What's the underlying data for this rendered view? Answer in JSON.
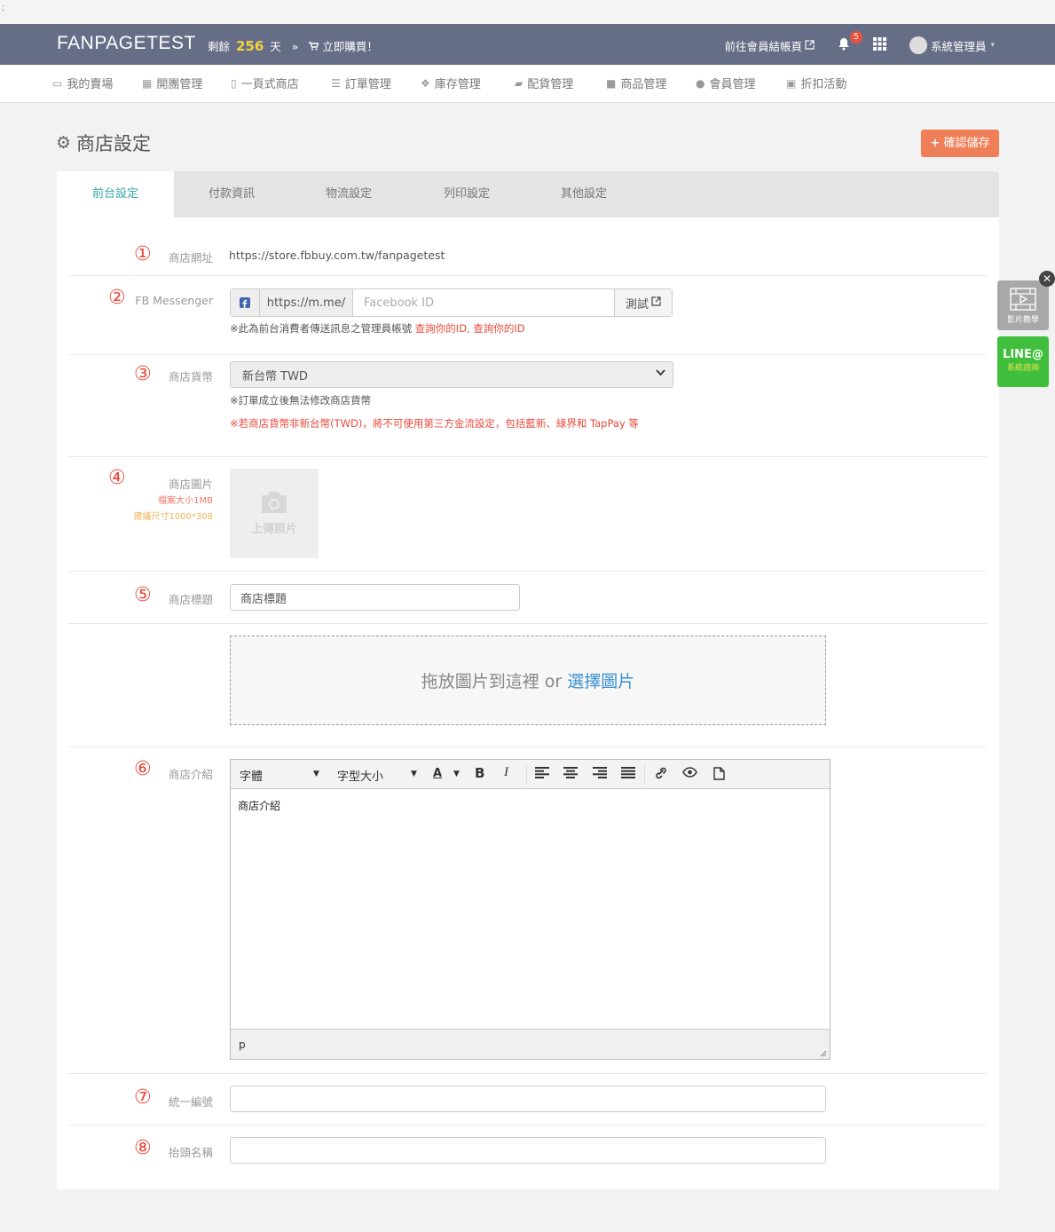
{
  "strip": {
    "text": ";"
  },
  "header": {
    "brand": "FANPAGETEST",
    "remain_prefix": "剩餘",
    "remain_days": "256",
    "remain_suffix": "天",
    "arrow": "»",
    "buy_label": "立即購買！",
    "member_checkout": "前往會員結帳頁",
    "notification_count": "5",
    "user_name": "系統管理員"
  },
  "nav": {
    "items": [
      {
        "label": "我的賣場",
        "icon": "store-icon"
      },
      {
        "label": "開團管理",
        "icon": "calendar-icon"
      },
      {
        "label": "一頁式商店",
        "icon": "file-icon"
      },
      {
        "label": "訂單管理",
        "icon": "list-icon"
      },
      {
        "label": "庫存管理",
        "icon": "cubes-icon"
      },
      {
        "label": "配貨管理",
        "icon": "truck-icon"
      },
      {
        "label": "商品管理",
        "icon": "archive-icon"
      },
      {
        "label": "會員管理",
        "icon": "users-icon"
      },
      {
        "label": "折扣活動",
        "icon": "money-icon"
      }
    ]
  },
  "page": {
    "title": "商店設定",
    "save_label": "確認儲存"
  },
  "tabs": [
    {
      "label": "前台設定",
      "active": true
    },
    {
      "label": "付款資訊",
      "active": false
    },
    {
      "label": "物流設定",
      "active": false
    },
    {
      "label": "列印設定",
      "active": false
    },
    {
      "label": "其他設定",
      "active": false
    }
  ],
  "form": {
    "url": {
      "num": "①",
      "label": "商店網址",
      "value": "https://store.fbbuy.com.tw/fanpagetest"
    },
    "messenger": {
      "num": "②",
      "label": "FB Messenger",
      "prefix": "https://m.me/",
      "placeholder": "Facebook ID",
      "test_label": "測試",
      "note_prefix": "※此為前台消費者傳送訊息之管理員帳號",
      "note_link": "查詢你的ID, 查詢你的ID"
    },
    "currency": {
      "num": "③",
      "label": "商店貨幣",
      "selected": "新台幣 TWD",
      "note1": "※訂單成立後無法修改商店貨幣",
      "note2": "※若商店貨幣非新台幣(TWD)，將不可使用第三方金流設定，包括藍新、綠界和 TapPay 等"
    },
    "image": {
      "num": "④",
      "label": "商店圖片",
      "size_note": "檔案大小1MB",
      "dim_note": "建議尺寸1000*308",
      "upload_label": "上傳照片"
    },
    "title": {
      "num": "⑤",
      "label": "商店標題",
      "value": "商店標題"
    },
    "dropzone": {
      "text": "拖放圖片到這裡 or",
      "link": "選擇圖片"
    },
    "intro": {
      "num": "⑥",
      "label": "商店介紹",
      "font_label": "字體",
      "size_label": "字型大小",
      "content": "商店介紹",
      "status": "p"
    },
    "tax_id": {
      "num": "⑦",
      "label": "統一編號",
      "value": ""
    },
    "invoice_title": {
      "num": "⑧",
      "label": "抬頭名稱",
      "value": ""
    }
  },
  "side": {
    "video_label": "影片教學",
    "line_label": "LINE@",
    "line_sub": "系統諮詢"
  },
  "colors": {
    "topbar": "#666d87",
    "accent": "#3aa5a5",
    "save": "#ef7f58",
    "red": "#e84a3c",
    "line": "#3fbf3b"
  }
}
